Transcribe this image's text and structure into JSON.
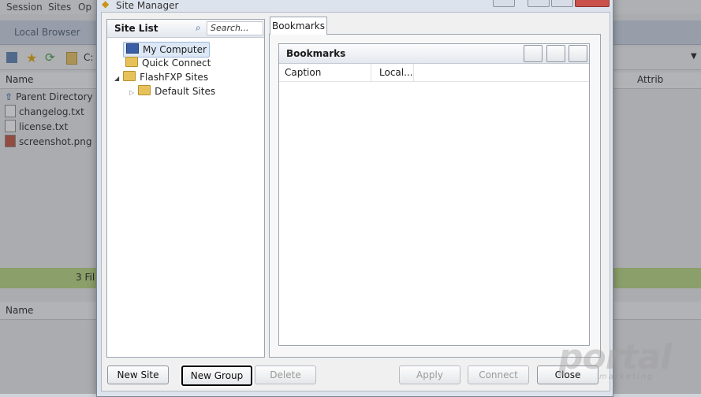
{
  "menubar": {
    "items": [
      "Session",
      "Sites",
      "Op"
    ]
  },
  "local_browser": {
    "tab_label": "Local Browser",
    "path_value": "C:",
    "column_name": "Name",
    "column_attrib": "Attrib",
    "files": [
      {
        "name": "Parent Directory",
        "icon": "parent-directory-icon"
      },
      {
        "name": "changelog.txt",
        "icon": "text-file-icon"
      },
      {
        "name": "license.txt",
        "icon": "text-file-icon"
      },
      {
        "name": "screenshot.png",
        "icon": "image-file-icon"
      }
    ],
    "status_text": "3 Fil",
    "queue_column_name": "Name"
  },
  "dialog": {
    "title": "Site Manager",
    "site_list": {
      "header": "Site List",
      "search_placeholder": "Search...",
      "tree": [
        {
          "label": "My Computer",
          "selected": true,
          "icon": "computer-icon"
        },
        {
          "label": "Quick Connect",
          "icon": "folder-icon"
        },
        {
          "label": "FlashFXP Sites",
          "icon": "folder-icon",
          "expanded": true
        },
        {
          "label": "Default Sites",
          "icon": "folder-icon",
          "indent": true
        }
      ]
    },
    "tab_label": "Bookmarks",
    "bookmarks": {
      "header": "Bookmarks",
      "col_caption": "Caption",
      "col_local": "Local..."
    },
    "buttons": {
      "new_site": "New Site",
      "new_group": "New Group",
      "delete": "Delete",
      "apply": "Apply",
      "connect": "Connect",
      "close": "Close"
    }
  },
  "watermark": {
    "text": "portal",
    "sub": "marketing"
  }
}
